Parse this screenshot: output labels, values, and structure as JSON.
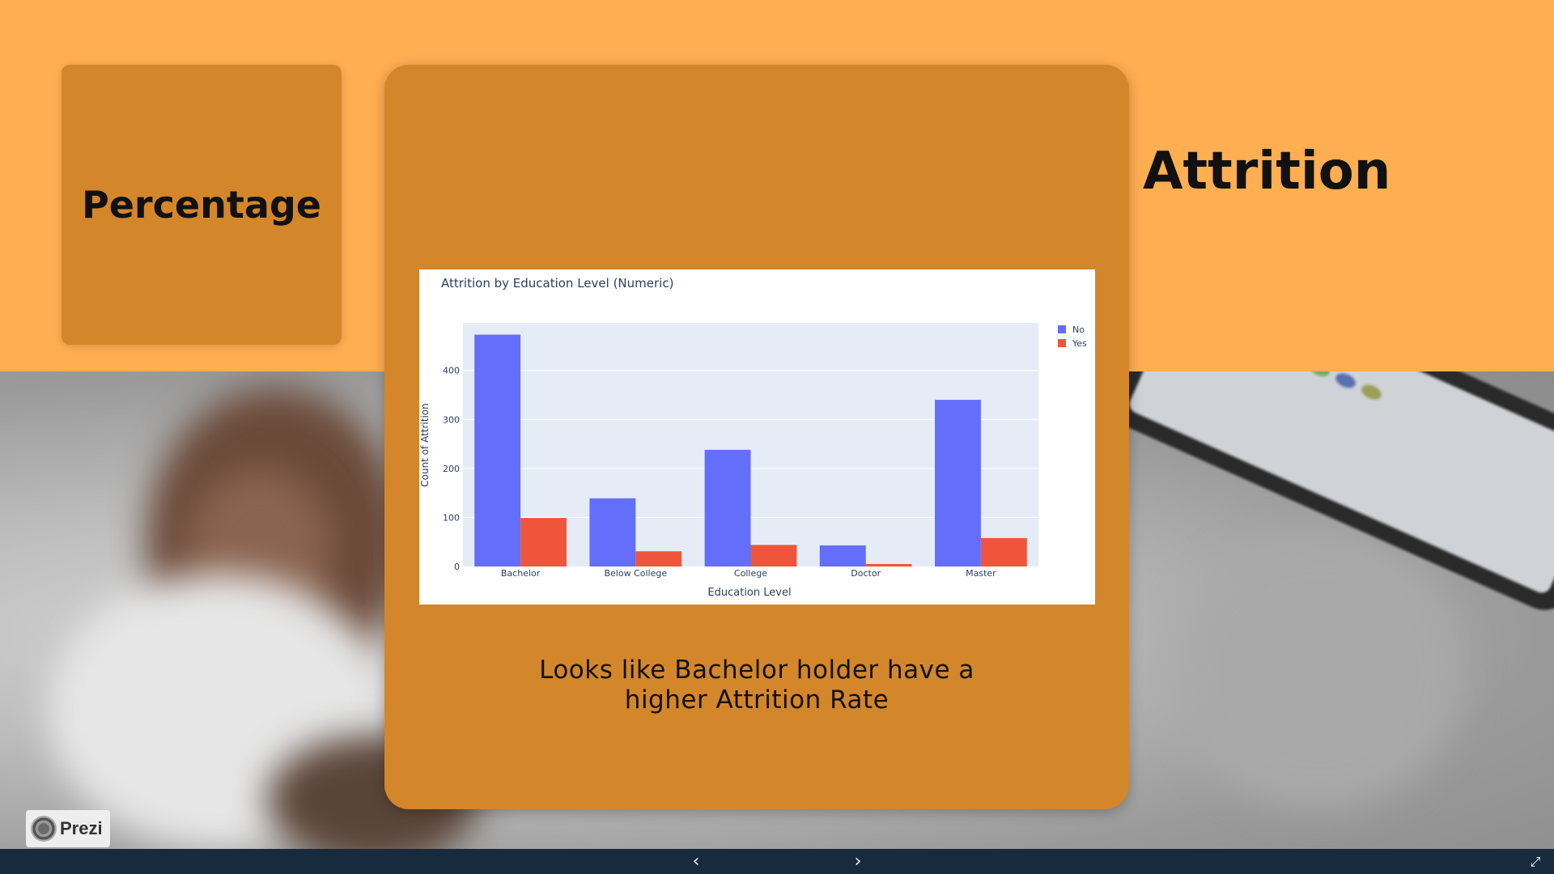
{
  "left_card": {
    "title": "Percentage"
  },
  "right_title": "Attrition",
  "caption": {
    "line1": "Looks like Bachelor holder have a",
    "line2": "higher Attrition Rate"
  },
  "branding": {
    "badge_label": "Prezi"
  },
  "navigation": {
    "prev_icon": "chevron-left-icon",
    "next_icon": "chevron-right-icon",
    "fullscreen_icon": "fullscreen-icon"
  },
  "colors": {
    "band": "#ffae52",
    "card": "#d4862a",
    "bar_no": "#636efa",
    "bar_yes": "#ef553b",
    "plot_bg": "#e5ecf6"
  },
  "chart_data": {
    "type": "bar",
    "title": "Attrition by Education Level (Numeric)",
    "xlabel": "Education Level",
    "ylabel": "Count of Attrition",
    "categories": [
      "Bachelor",
      "Below College",
      "College",
      "Doctor",
      "Master"
    ],
    "series": [
      {
        "name": "No",
        "values": [
          473,
          139,
          238,
          43,
          340
        ]
      },
      {
        "name": "Yes",
        "values": [
          99,
          31,
          44,
          5,
          58
        ]
      }
    ],
    "yticks": [
      0,
      100,
      200,
      300,
      400
    ],
    "ylim": [
      0,
      497
    ],
    "legend": "top-right",
    "grid": true
  }
}
